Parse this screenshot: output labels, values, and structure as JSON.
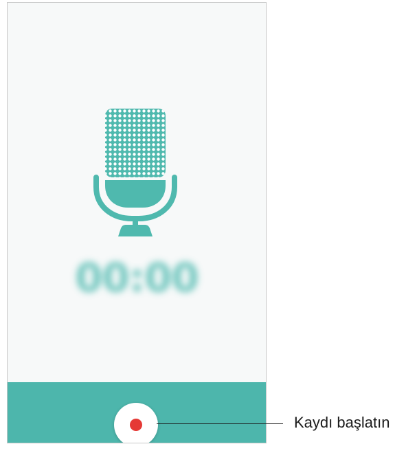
{
  "recorder": {
    "timer": "00:00",
    "record_button_icon": "record-dot-icon",
    "mic_icon": "microphone-icon"
  },
  "callout": {
    "label": "Kaydı başlatın"
  },
  "colors": {
    "accent": "#4db6ac",
    "record": "#e53935",
    "background": "#f7f9f9"
  }
}
